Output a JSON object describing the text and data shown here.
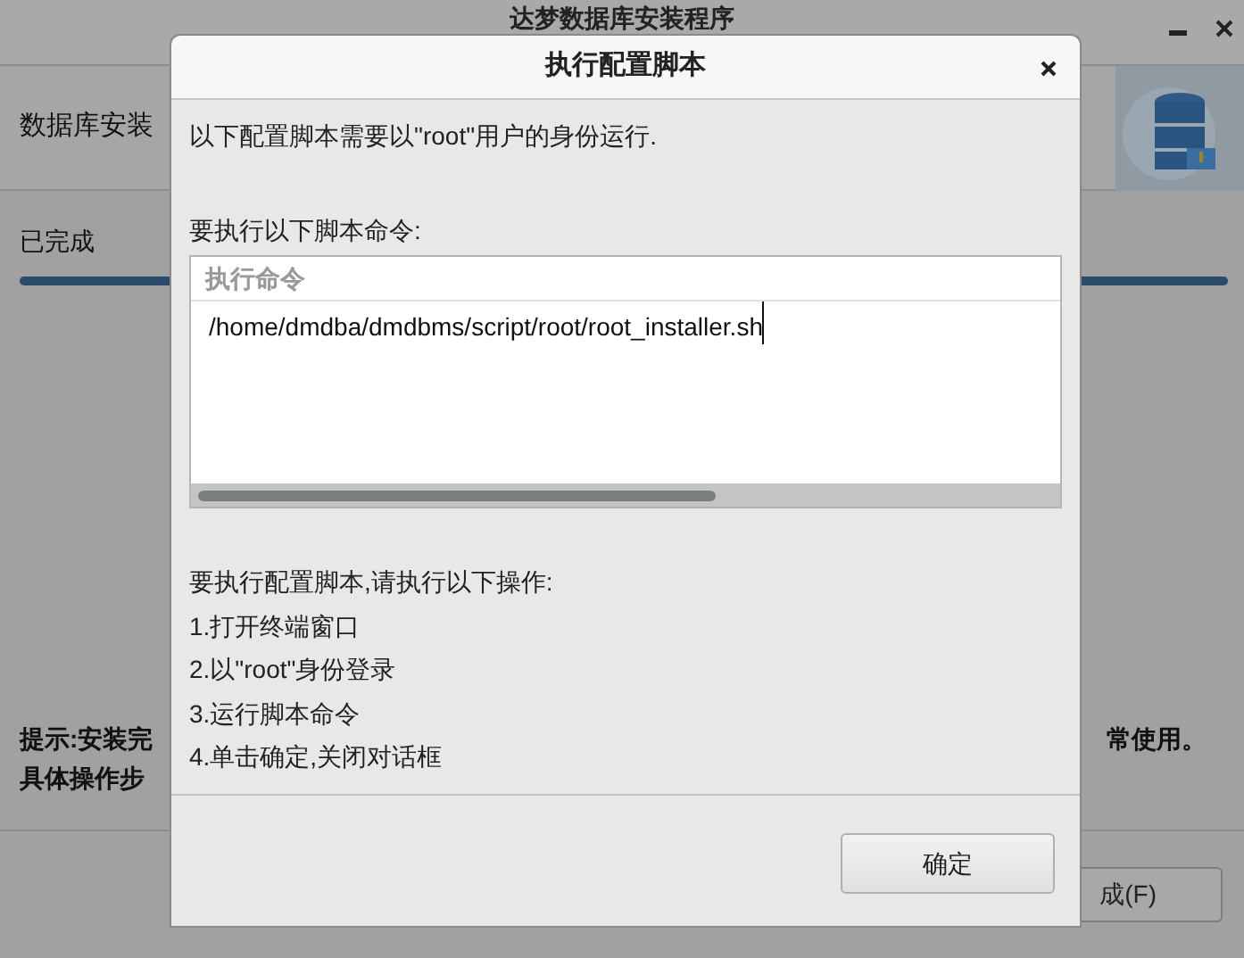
{
  "installer": {
    "title": "达梦数据库安装程序",
    "header_text": "数据库安装",
    "progress_label": "已完成",
    "progress": {
      "level": 1.0
    },
    "hint_left": [
      "提示:安装完",
      "具体操作步"
    ],
    "hint_right": "常使用。",
    "finish_button": "成(F)"
  },
  "dialog": {
    "title": "执行配置脚本",
    "intro": "以下配置脚本需要以\"root\"用户的身份运行.",
    "commands_label": "要执行以下脚本命令:",
    "table": {
      "columns": [
        "执行命令"
      ],
      "rows": [
        [
          "/home/dmdba/dmdbms/script/root/root_installer.sh"
        ]
      ]
    },
    "steps_label": "要执行配置脚本,请执行以下操作:",
    "steps": [
      "1.打开终端窗口",
      "2.以\"root\"身份登录",
      "3.运行脚本命令",
      "4.单击确定,关闭对话框"
    ],
    "ok_button": "确定"
  }
}
